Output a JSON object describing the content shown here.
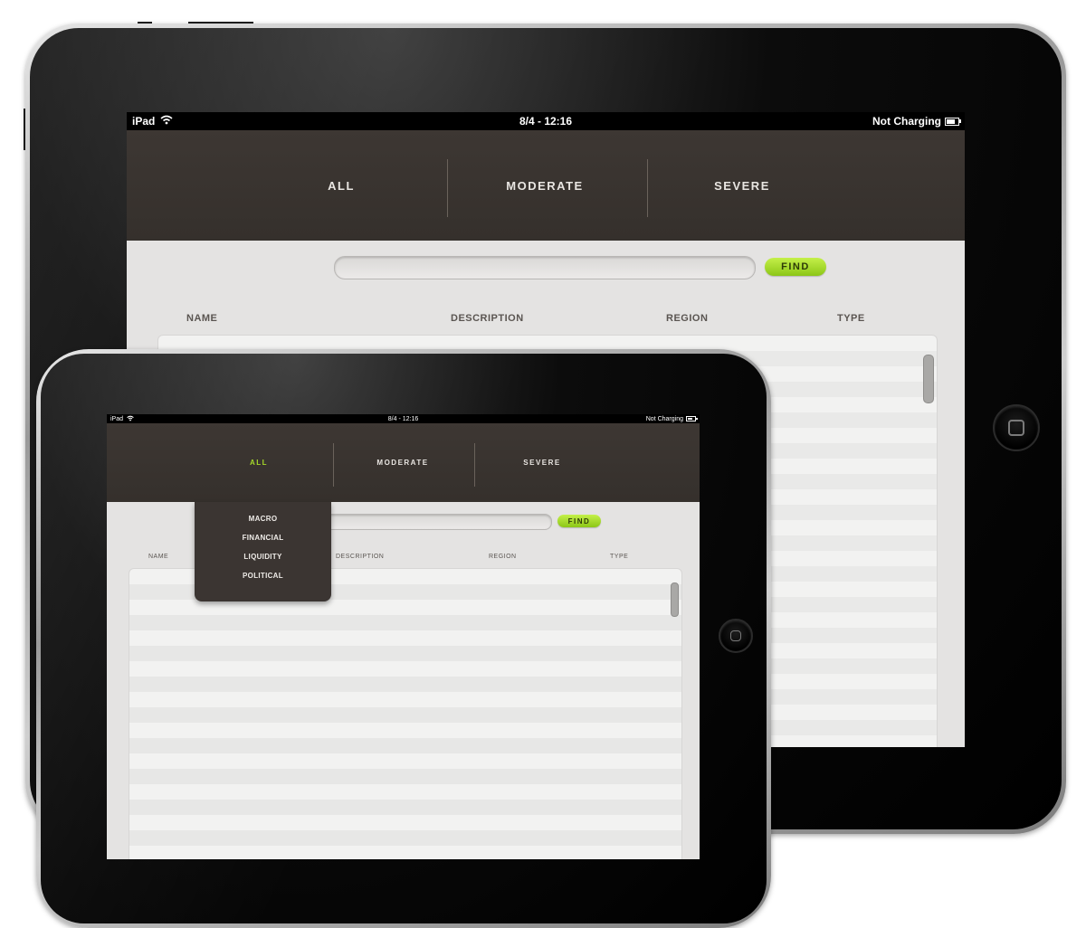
{
  "status_bar": {
    "device": "iPad",
    "time": "8/4 - 12:16",
    "power": "Not Charging"
  },
  "nav": {
    "tabs": [
      "ALL",
      "MODERATE",
      "SEVERE"
    ],
    "active_color_small": "#a6d92a"
  },
  "search": {
    "find_label": "FIND",
    "value": "",
    "placeholder": ""
  },
  "columns": [
    "NAME",
    "DESCRIPTION",
    "REGION",
    "TYPE"
  ],
  "dropdown": {
    "items": [
      "MACRO",
      "FINANCIAL",
      "LIQUIDITY",
      "POLITICAL"
    ]
  },
  "colors": {
    "nav_bg": "#393430",
    "find_green": "#a6d92a",
    "screen_bg": "#e4e3e2"
  },
  "icons": [
    "wifi-icon",
    "battery-icon",
    "home-button-square-icon"
  ]
}
